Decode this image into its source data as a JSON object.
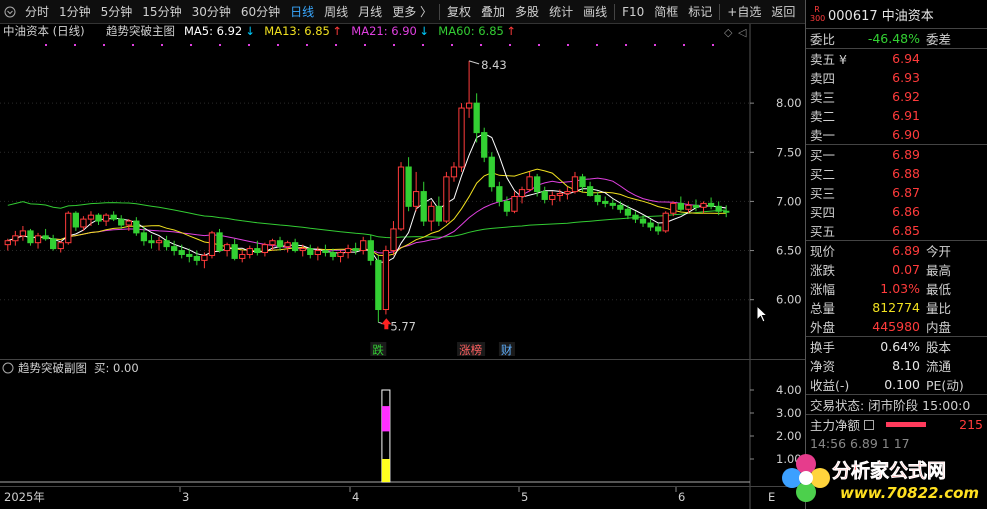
{
  "toolbar": {
    "items": [
      "分时",
      "1分钟",
      "5分钟",
      "15分钟",
      "30分钟",
      "60分钟",
      "日线",
      "周线",
      "月线",
      "更多 〉",
      "复权",
      "叠加",
      "多股",
      "统计",
      "画线",
      "F10",
      "简框",
      "标记",
      "+自选",
      "返回"
    ],
    "active_index": 6
  },
  "main_chart": {
    "title": "中油资本 (日线)",
    "indicator_name": "趋势突破主图",
    "ma_legends": [
      {
        "label": "MA5: 6.92",
        "arrow": "↓",
        "color": "#ffffff",
        "arrow_color": "#00ccff"
      },
      {
        "label": "MA13: 6.85",
        "arrow": "↑",
        "color": "#f0e020",
        "arrow_color": "#ff3b3b"
      },
      {
        "label": "MA21: 6.90",
        "arrow": "↓",
        "color": "#e040e0",
        "arrow_color": "#00ccff"
      },
      {
        "label": "MA60: 6.85",
        "arrow": "↑",
        "color": "#33cc33",
        "arrow_color": "#ff3b3b"
      }
    ],
    "high_label": "8.43",
    "low_label": "5.77",
    "event_labels": [
      {
        "text": "跌",
        "color": "#33d033"
      },
      {
        "text": "涨榜",
        "color": "#ff6060"
      },
      {
        "text": "财",
        "color": "#60b0ff"
      }
    ],
    "y_ticks": [
      "8.00",
      "7.50",
      "7.00",
      "6.50",
      "6.00"
    ]
  },
  "sub_chart": {
    "title": "趋势突破副图",
    "value_label": "买: 0.00",
    "y_ticks": [
      "4.00",
      "3.00",
      "2.00",
      "1.00"
    ]
  },
  "time_axis": {
    "labels": [
      "2025年",
      "3",
      "4",
      "5",
      "6",
      "E"
    ]
  },
  "chart_data": {
    "type": "candlestick",
    "y_range": [
      5.6,
      8.5
    ],
    "candles": [
      [
        6.56,
        6.62,
        6.5,
        6.6
      ],
      [
        6.6,
        6.7,
        6.55,
        6.65
      ],
      [
        6.65,
        6.75,
        6.6,
        6.7
      ],
      [
        6.7,
        6.72,
        6.55,
        6.58
      ],
      [
        6.58,
        6.68,
        6.52,
        6.65
      ],
      [
        6.65,
        6.72,
        6.6,
        6.62
      ],
      [
        6.62,
        6.66,
        6.5,
        6.52
      ],
      [
        6.52,
        6.6,
        6.48,
        6.58
      ],
      [
        6.58,
        6.9,
        6.56,
        6.88
      ],
      [
        6.88,
        6.9,
        6.7,
        6.74
      ],
      [
        6.74,
        6.85,
        6.7,
        6.82
      ],
      [
        6.82,
        6.9,
        6.75,
        6.86
      ],
      [
        6.86,
        6.88,
        6.76,
        6.8
      ],
      [
        6.8,
        6.88,
        6.75,
        6.86
      ],
      [
        6.86,
        6.9,
        6.8,
        6.82
      ],
      [
        6.82,
        6.86,
        6.72,
        6.76
      ],
      [
        6.76,
        6.82,
        6.7,
        6.8
      ],
      [
        6.8,
        6.84,
        6.65,
        6.68
      ],
      [
        6.68,
        6.74,
        6.55,
        6.6
      ],
      [
        6.6,
        6.66,
        6.52,
        6.58
      ],
      [
        6.58,
        6.64,
        6.5,
        6.6
      ],
      [
        6.6,
        6.65,
        6.5,
        6.54
      ],
      [
        6.54,
        6.6,
        6.45,
        6.5
      ],
      [
        6.5,
        6.56,
        6.42,
        6.46
      ],
      [
        6.46,
        6.52,
        6.38,
        6.44
      ],
      [
        6.44,
        6.5,
        6.35,
        6.4
      ],
      [
        6.4,
        6.48,
        6.32,
        6.45
      ],
      [
        6.45,
        6.7,
        6.42,
        6.68
      ],
      [
        6.68,
        6.72,
        6.48,
        6.5
      ],
      [
        6.5,
        6.58,
        6.44,
        6.56
      ],
      [
        6.56,
        6.62,
        6.4,
        6.42
      ],
      [
        6.42,
        6.5,
        6.38,
        6.46
      ],
      [
        6.46,
        6.55,
        6.42,
        6.52
      ],
      [
        6.52,
        6.6,
        6.45,
        6.48
      ],
      [
        6.48,
        6.58,
        6.44,
        6.56
      ],
      [
        6.56,
        6.62,
        6.5,
        6.6
      ],
      [
        6.6,
        6.64,
        6.5,
        6.54
      ],
      [
        6.54,
        6.6,
        6.48,
        6.58
      ],
      [
        6.58,
        6.62,
        6.48,
        6.5
      ],
      [
        6.5,
        6.56,
        6.44,
        6.52
      ],
      [
        6.52,
        6.56,
        6.42,
        6.46
      ],
      [
        6.46,
        6.54,
        6.4,
        6.5
      ],
      [
        6.5,
        6.56,
        6.44,
        6.48
      ],
      [
        6.48,
        6.52,
        6.4,
        6.44
      ],
      [
        6.44,
        6.5,
        6.38,
        6.48
      ],
      [
        6.48,
        6.56,
        6.42,
        6.52
      ],
      [
        6.52,
        6.58,
        6.46,
        6.5
      ],
      [
        6.5,
        6.64,
        6.46,
        6.6
      ],
      [
        6.6,
        6.66,
        6.35,
        6.4
      ],
      [
        6.4,
        6.45,
        5.77,
        5.9
      ],
      [
        5.9,
        6.55,
        5.85,
        6.5
      ],
      [
        6.5,
        6.8,
        6.45,
        6.72
      ],
      [
        6.72,
        7.4,
        6.7,
        7.35
      ],
      [
        7.35,
        7.45,
        6.9,
        6.95
      ],
      [
        6.95,
        7.3,
        6.9,
        7.1
      ],
      [
        7.1,
        7.2,
        6.75,
        6.8
      ],
      [
        6.8,
        7.0,
        6.7,
        6.95
      ],
      [
        6.95,
        7.05,
        6.75,
        6.8
      ],
      [
        6.8,
        7.3,
        6.78,
        7.25
      ],
      [
        7.25,
        7.4,
        7.2,
        7.35
      ],
      [
        7.35,
        8.0,
        7.3,
        7.95
      ],
      [
        7.95,
        8.43,
        7.85,
        8.0
      ],
      [
        8.0,
        8.1,
        7.6,
        7.7
      ],
      [
        7.7,
        7.75,
        7.4,
        7.45
      ],
      [
        7.45,
        7.5,
        7.1,
        7.15
      ],
      [
        7.15,
        7.2,
        6.95,
        7.0
      ],
      [
        7.0,
        7.05,
        6.85,
        6.9
      ],
      [
        6.9,
        7.1,
        6.88,
        7.05
      ],
      [
        7.05,
        7.15,
        6.98,
        7.12
      ],
      [
        7.12,
        7.3,
        7.1,
        7.25
      ],
      [
        7.25,
        7.28,
        7.05,
        7.1
      ],
      [
        7.1,
        7.15,
        6.98,
        7.02
      ],
      [
        7.02,
        7.1,
        6.96,
        7.06
      ],
      [
        7.06,
        7.12,
        7.0,
        7.08
      ],
      [
        7.08,
        7.15,
        7.02,
        7.1
      ],
      [
        7.1,
        7.3,
        7.08,
        7.25
      ],
      [
        7.25,
        7.28,
        7.1,
        7.15
      ],
      [
        7.15,
        7.2,
        7.05,
        7.06
      ],
      [
        7.06,
        7.1,
        6.96,
        7.0
      ],
      [
        7.0,
        7.05,
        6.94,
        6.98
      ],
      [
        6.98,
        7.02,
        6.92,
        6.96
      ],
      [
        6.96,
        7.0,
        6.88,
        6.92
      ],
      [
        6.92,
        6.96,
        6.82,
        6.86
      ],
      [
        6.86,
        6.9,
        6.78,
        6.82
      ],
      [
        6.82,
        6.86,
        6.74,
        6.78
      ],
      [
        6.78,
        6.82,
        6.7,
        6.74
      ],
      [
        6.74,
        6.78,
        6.66,
        6.7
      ],
      [
        6.7,
        6.9,
        6.68,
        6.88
      ],
      [
        6.88,
        7.0,
        6.85,
        6.98
      ],
      [
        6.98,
        7.05,
        6.9,
        6.92
      ],
      [
        6.92,
        7.0,
        6.88,
        6.96
      ],
      [
        6.96,
        7.02,
        6.9,
        6.94
      ],
      [
        6.94,
        7.0,
        6.88,
        6.98
      ],
      [
        6.98,
        7.04,
        6.92,
        6.95
      ],
      [
        6.95,
        7.0,
        6.86,
        6.9
      ],
      [
        6.9,
        6.96,
        6.84,
        6.89
      ]
    ],
    "sub_spike": {
      "index": 50,
      "value": 4.0,
      "magenta_from": 2.2,
      "magenta_to": 3.3
    }
  },
  "right_panel": {
    "badge": "R 300",
    "stock": "000617 中油资本",
    "weibi": {
      "label": "委比",
      "value": "-46.48%",
      "label2": "委差"
    },
    "asks": [
      {
        "label": "卖五 ¥",
        "price": "6.94"
      },
      {
        "label": "卖四",
        "price": "6.93"
      },
      {
        "label": "卖三",
        "price": "6.92"
      },
      {
        "label": "卖二",
        "price": "6.91"
      },
      {
        "label": "卖一",
        "price": "6.90"
      }
    ],
    "bids": [
      {
        "label": "买一",
        "price": "6.89"
      },
      {
        "label": "买二",
        "price": "6.88"
      },
      {
        "label": "买三",
        "price": "6.87"
      },
      {
        "label": "买四",
        "price": "6.86"
      },
      {
        "label": "买五",
        "price": "6.85"
      }
    ],
    "quotes": [
      {
        "label": "现价",
        "value": "6.89",
        "label2": "今开",
        "color": "red"
      },
      {
        "label": "涨跌",
        "value": "0.07",
        "label2": "最高",
        "color": "red"
      },
      {
        "label": "涨幅",
        "value": "1.03%",
        "label2": "最低",
        "color": "red"
      },
      {
        "label": "总量",
        "value": "812774",
        "label2": "量比",
        "color": "yellow"
      },
      {
        "label": "外盘",
        "value": "445980",
        "label2": "内盘",
        "color": "red"
      }
    ],
    "stats": [
      {
        "label": "换手",
        "value": "0.64%",
        "label2": "股本"
      },
      {
        "label": "净资",
        "value": "8.10",
        "label2": "流通"
      },
      {
        "label": "收益(-)",
        "value": "0.100",
        "label2": "PE(动)"
      }
    ],
    "trade_status": "交易状态: 闭市阶段 15:00:0",
    "main_net": {
      "label": "主力净额",
      "value": "215"
    },
    "partial_row": "14:56   6.89   1 17"
  },
  "watermark": {
    "text": "分析家公式网",
    "url": "www.70822.com"
  }
}
